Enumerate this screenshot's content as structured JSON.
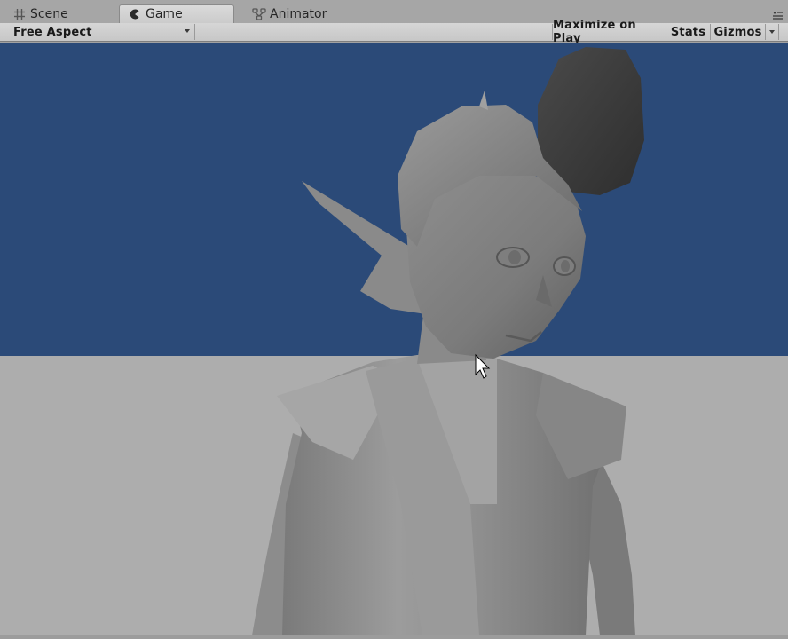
{
  "tabs": [
    {
      "label": "Scene",
      "icon": "hash-grid-icon",
      "active": false
    },
    {
      "label": "Game",
      "icon": "pacman-icon",
      "active": true
    },
    {
      "label": "Animator",
      "icon": "animator-nodes-icon",
      "active": false
    }
  ],
  "toolbar": {
    "aspect_label": "Free Aspect",
    "maximize_label": "Maximize on Play",
    "stats_label": "Stats",
    "gizmos_label": "Gizmos"
  },
  "viewport": {
    "sky_color": "#2b4a78",
    "ground_color": "#adadad",
    "model_base_color": "#8a8a8a"
  }
}
